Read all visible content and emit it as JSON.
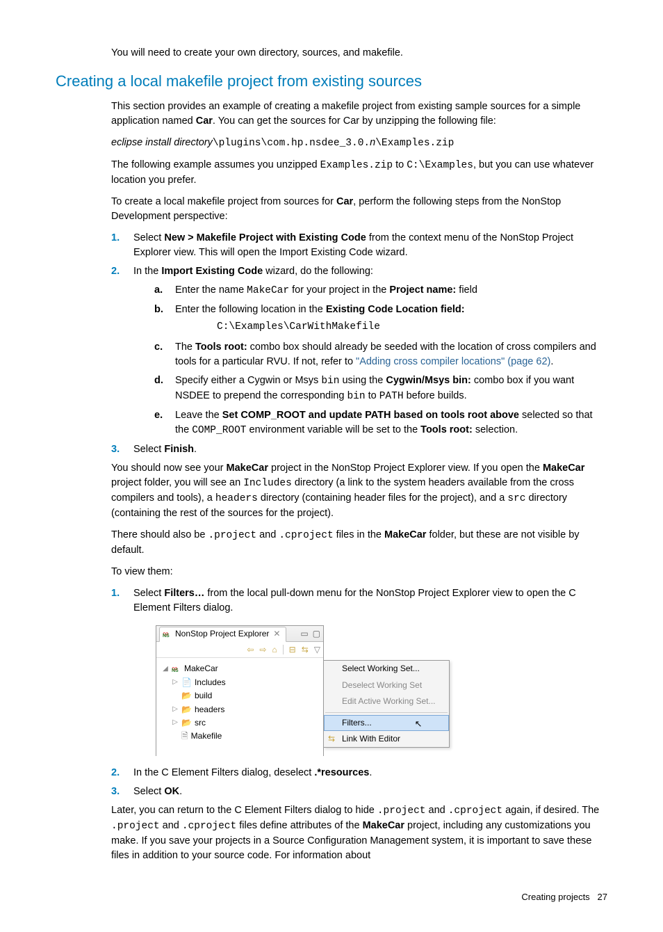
{
  "intro": "You will need to create your own directory, sources, and makefile.",
  "heading": "Creating a local makefile project from existing sources",
  "para1a": "This section provides an example of creating a makefile project from existing sample sources for a simple application named ",
  "bold_car": "Car",
  "para1b": ". You can get the sources for Car by unzipping the following file:",
  "path_italic": "eclipse install directory",
  "path_mono1": "\\plugins\\com.hp.nsdee_3.0.",
  "path_n": "n",
  "path_mono2": "\\Examples.zip",
  "para2a": "The following example assumes you unzipped ",
  "examples_zip": "Examples.zip",
  "para2b": " to ",
  "c_examples": "C:\\Examples",
  "para2c": ", but you can use whatever location you prefer.",
  "para3a": "To create a local makefile project from sources for ",
  "para3b": ", perform the following steps from the NonStop Development perspective:",
  "step1a": "Select ",
  "step1_menu": "New > Makefile Project with Existing Code",
  "step1b": " from the context menu of the NonStop Project Explorer view. This will open the Import Existing Code wizard.",
  "step2a": "In the ",
  "step2_wiz": "Import Existing Code",
  "step2b": " wizard, do the following:",
  "sub_a1": "Enter the name ",
  "sub_a_mono": "MakeCar",
  "sub_a2": " for your project in the ",
  "sub_a_bold": "Project name:",
  "sub_a3": " field",
  "sub_b1": "Enter the following location in the ",
  "sub_b_bold": "Existing Code Location field:",
  "sub_b_code": "C:\\Examples\\CarWithMakefile",
  "sub_c1": "The ",
  "sub_c_bold": "Tools root:",
  "sub_c2": " combo box should already be seeded with the location of cross compilers and tools for a particular RVU. If not, refer to ",
  "sub_c_link": "\"Adding cross compiler locations\" (page 62)",
  "sub_c3": ".",
  "sub_d1": "Specify either a Cygwin or Msys ",
  "sub_d_bin": "bin",
  "sub_d2": " using the ",
  "sub_d_bold": "Cygwin/Msys bin:",
  "sub_d3": " combo box if you want NSDEE to prepend the corresponding ",
  "sub_d4": " to ",
  "sub_d_path": "PATH",
  "sub_d5": " before builds.",
  "sub_e1": "Leave the ",
  "sub_e_bold": "Set COMP_ROOT and update PATH based on tools root above",
  "sub_e2": " selected so that the ",
  "sub_e_mono": "COMP_ROOT",
  "sub_e3": " environment variable will be set to the ",
  "sub_e_bold2": "Tools root:",
  "sub_e4": " selection.",
  "step3a": "Select ",
  "step3_finish": "Finish",
  "step3b": ".",
  "para4a": "You should now see your ",
  "para4_makecar": "MakeCar",
  "para4b": " project in the NonStop Project Explorer view. If you open the ",
  "para4c": " project folder, you will see an ",
  "para4_includes": "Includes",
  "para4d": " directory (a link to the system headers available from the cross compilers and tools), a ",
  "para4_headers": "headers",
  "para4e": " directory (containing header files for the project), and a ",
  "para4_src": "src",
  "para4f": " directory (containing the rest of the sources for the project).",
  "para5a": "There should also be ",
  "para5_proj": ".project",
  "para5b": " and ",
  "para5_cproj": ".cproject",
  "para5c": " files in the ",
  "para5d": " folder, but these are not visible by default.",
  "para6": "To view them:",
  "view1a": "Select ",
  "view1_filters": "Filters…",
  "view1b": " from the local pull-down menu for the NonStop Project Explorer view to open the C Element Filters dialog.",
  "explorer": {
    "tab": "NonStop Project Explorer",
    "tree": {
      "root": "MakeCar",
      "inc": "Includes",
      "build": "build",
      "headers": "headers",
      "src": "src",
      "makefile": "Makefile"
    }
  },
  "menu": {
    "select_ws": "Select Working Set...",
    "deselect_ws": "Deselect Working Set",
    "edit_ws": "Edit Active Working Set...",
    "filters": "Filters...",
    "link": "Link With Editor"
  },
  "view2a": "In the C Element Filters dialog, deselect ",
  "view2_bold": ".*resources",
  "view2b": ".",
  "view3a": "Select ",
  "view3_ok": "OK",
  "view3b": ".",
  "para7a": "Later, you can return to the C Element Filters dialog to hide ",
  "para7b": " again, if desired. The ",
  "para7c": " files define attributes of the ",
  "para7d": " project, including any customizations you make. If you save your projects in a Source Configuration Management system, it is important to save these files in addition to your source code. For information about",
  "footer_label": "Creating projects",
  "footer_page": "27"
}
